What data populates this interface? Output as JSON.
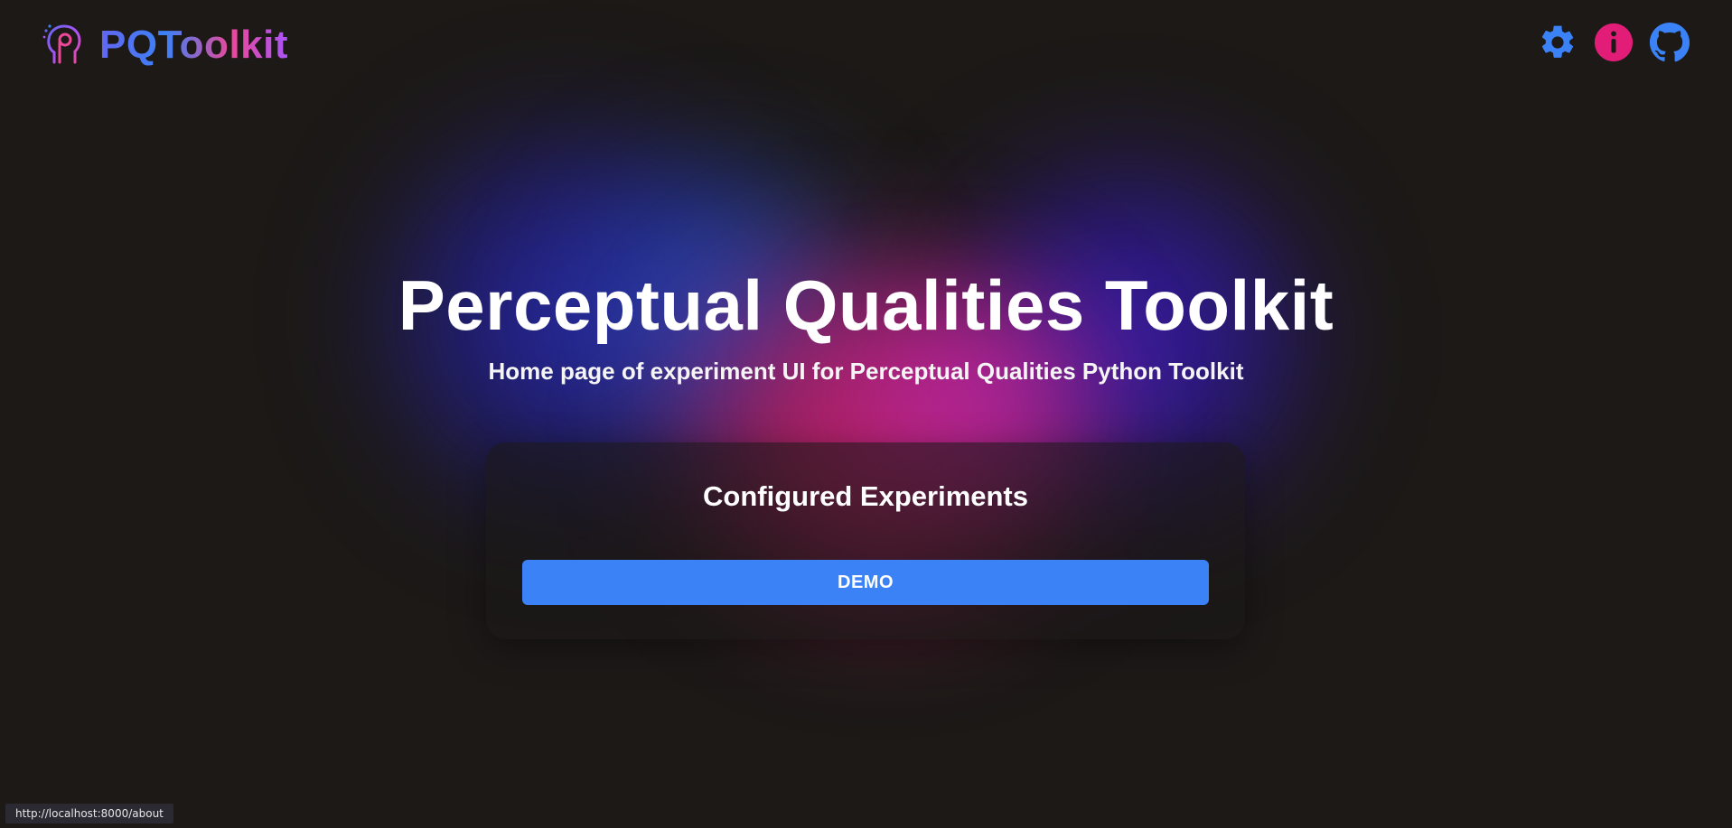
{
  "header": {
    "logo_text": "PQToolkit",
    "icons": {
      "settings": {
        "name": "gear-icon",
        "color": "#3b82f6"
      },
      "info": {
        "name": "info-icon",
        "color": "#e11d77"
      },
      "github": {
        "name": "github-icon",
        "color": "#3b82f6"
      }
    }
  },
  "hero": {
    "title": "Perceptual Qualities Toolkit",
    "subtitle": "Home page of experiment UI for Perceptual Qualities Python Toolkit"
  },
  "experiments": {
    "title": "Configured Experiments",
    "items": [
      {
        "label": "DEMO"
      }
    ]
  },
  "status_bar": {
    "url": "http://localhost:8000/about"
  },
  "colors": {
    "background": "#1c1917",
    "accent_blue": "#3b82f6",
    "accent_pink": "#e11d77"
  }
}
